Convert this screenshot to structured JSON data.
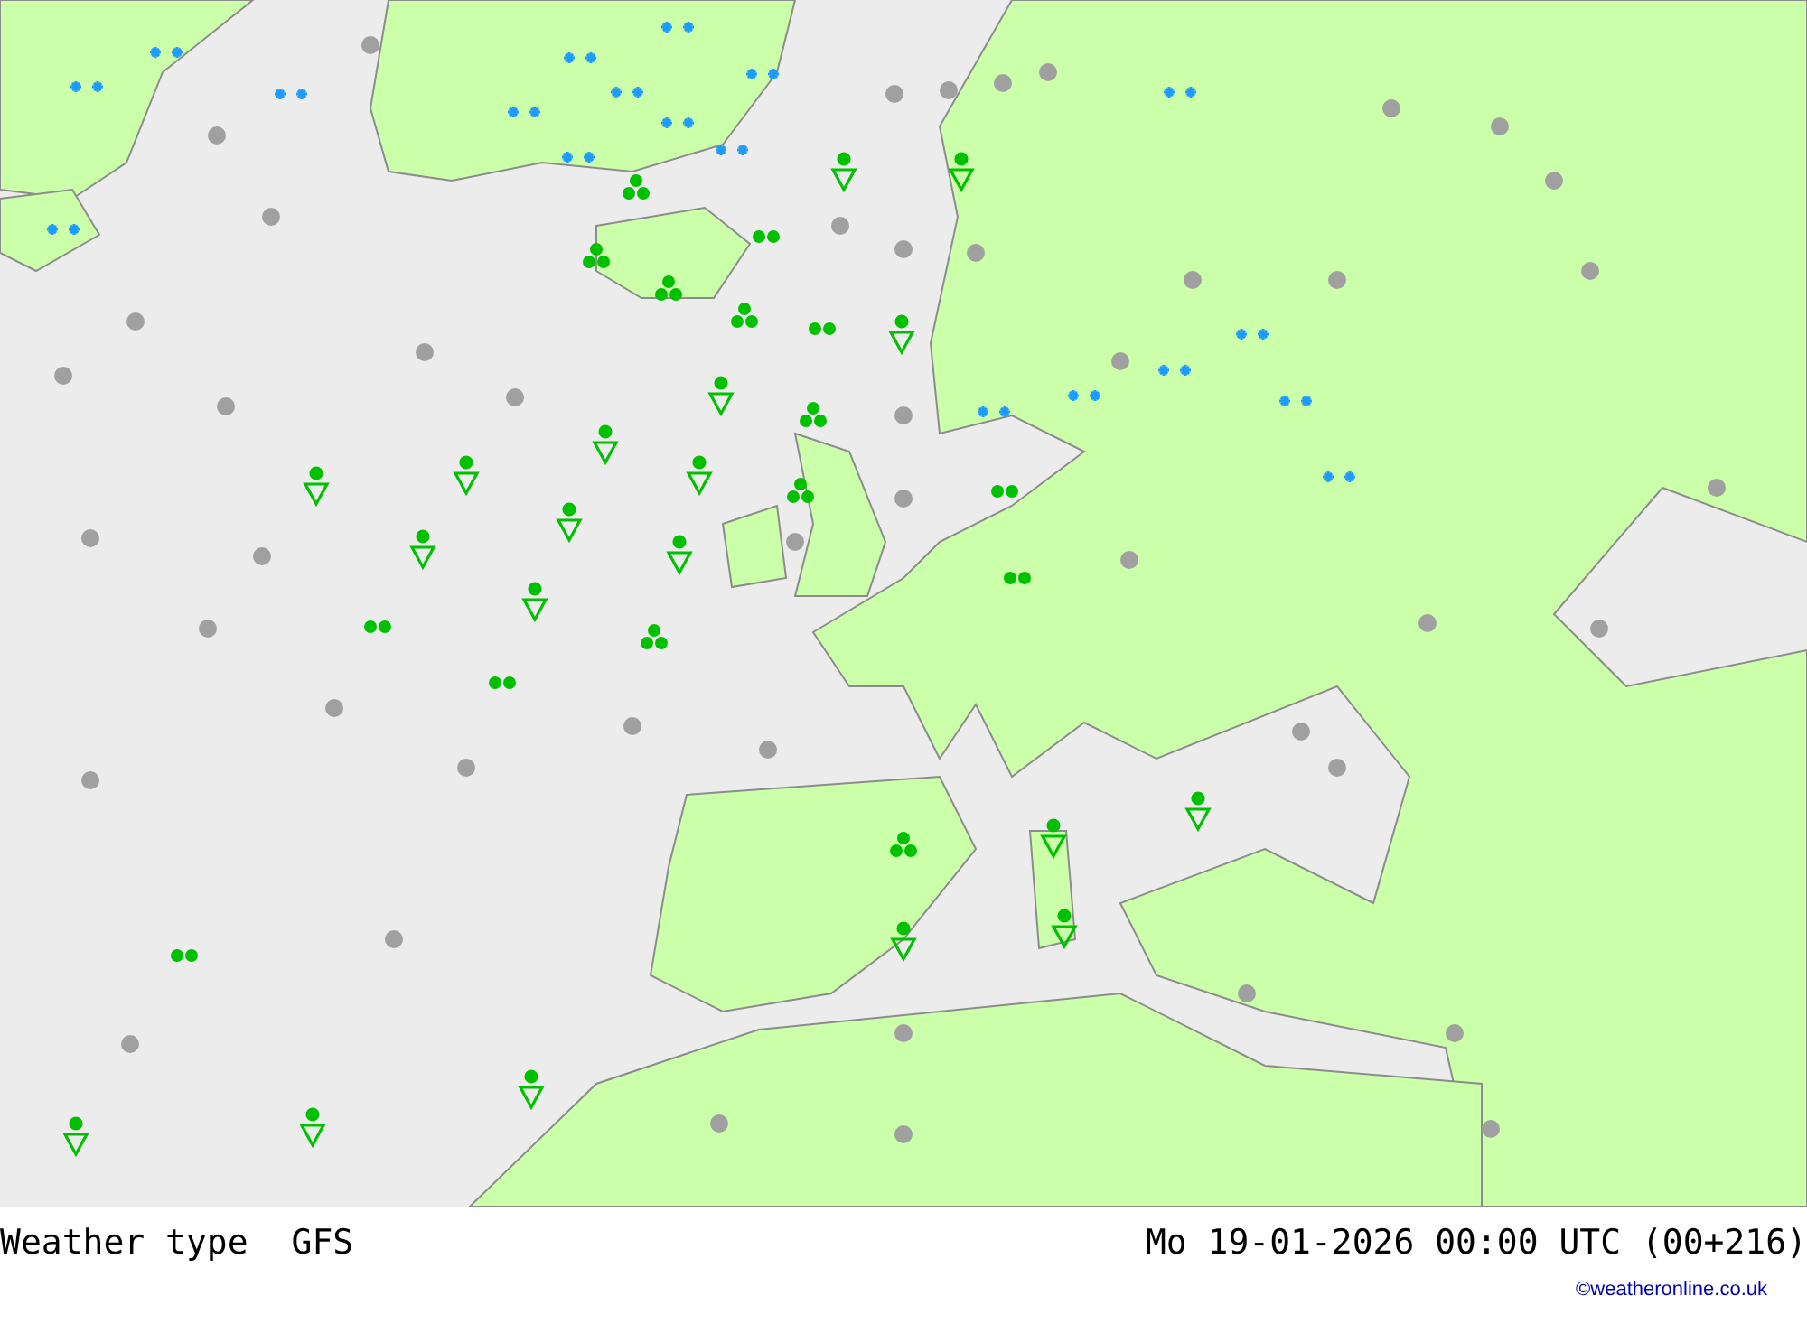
{
  "footer": {
    "title": "Weather type",
    "model": "GFS",
    "valid_time": "Mo 19-01-2026 00:00 UTC (00+216)",
    "credit": "©weatheronline.co.uk"
  }
}
